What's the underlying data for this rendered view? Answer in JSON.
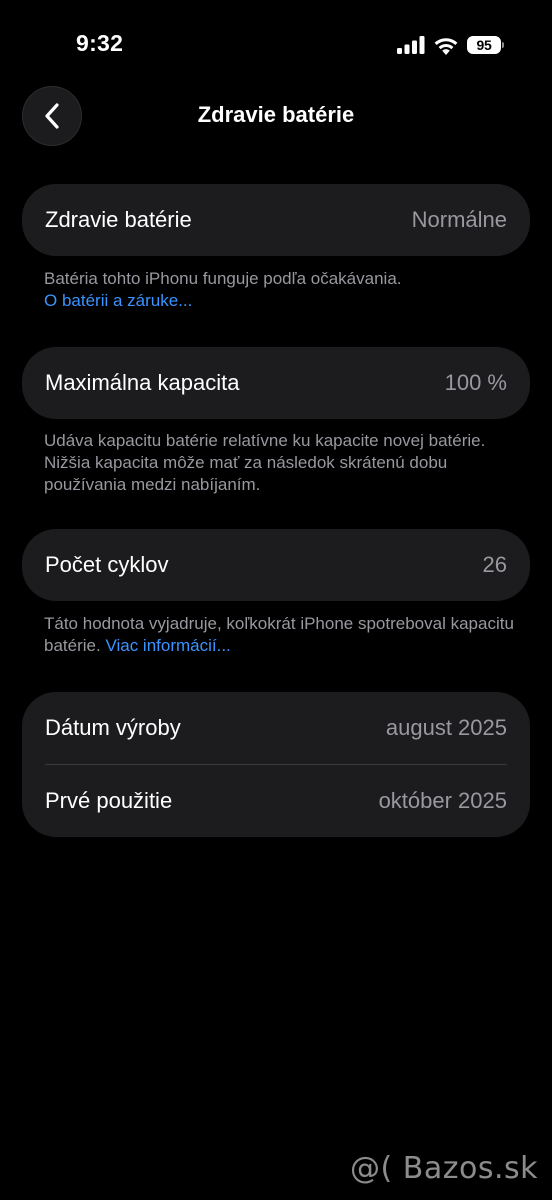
{
  "status_bar": {
    "time": "9:32",
    "battery_level": "95",
    "icons": [
      "cellular-signal-icon",
      "wifi-icon",
      "battery-icon"
    ]
  },
  "nav": {
    "back_icon": "chevron-left-icon",
    "title": "Zdravie batérie"
  },
  "battery_health": {
    "label": "Zdravie batérie",
    "value": "Normálne",
    "note": "Batéria tohto iPhonu funguje podľa očakávania.",
    "link": "O batérii a záruke..."
  },
  "max_capacity": {
    "label": "Maximálna kapacita",
    "value": "100 %",
    "note": "Udáva kapacitu batérie relatívne ku kapacite novej batérie. Nižšia kapacita môže mať za následok skrátenú dobu používania medzi nabíjaním."
  },
  "cycle_count": {
    "label": "Počet cyklov",
    "value": "26",
    "note": "Táto hodnota vyjadruje, koľkokrát iPhone spotreboval kapacitu batérie.",
    "link": "Viac informácií..."
  },
  "dates": {
    "manufacture_label": "Dátum výroby",
    "manufacture_value": "august 2025",
    "first_use_label": "Prvé použitie",
    "first_use_value": "október 2025"
  },
  "watermark": "@( Bazos.sk",
  "colors": {
    "background": "#000000",
    "card": "#1c1c1e",
    "secondary_text": "#98989f",
    "link": "#3a93ff"
  }
}
